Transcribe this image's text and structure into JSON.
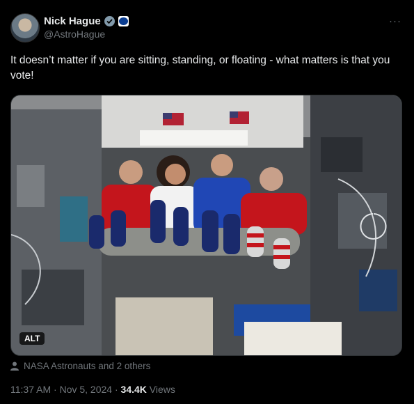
{
  "author": {
    "display_name": "Nick Hague",
    "handle": "@AstroHague",
    "verified_icon": "verified-badge-icon",
    "affiliation_icon": "nasa-logo-icon"
  },
  "menu": {
    "more_label": "···"
  },
  "post": {
    "text": "It doesn’t matter if you are sitting, standing, or floating  - what matters is that you vote!"
  },
  "media": {
    "alt_label": "ALT",
    "description_icon": "photo-icon"
  },
  "tags": {
    "icon": "person-icon",
    "text": "NASA Astronauts and 2 others"
  },
  "meta": {
    "time": "11:37 AM",
    "sep1": " · ",
    "date": "Nov 5, 2024",
    "sep2": " · ",
    "views_count": "34.4K",
    "views_label": " Views"
  },
  "colors": {
    "background": "#000000",
    "text": "#e7e9ea",
    "secondary": "#71767b",
    "verified": "#829aab"
  }
}
